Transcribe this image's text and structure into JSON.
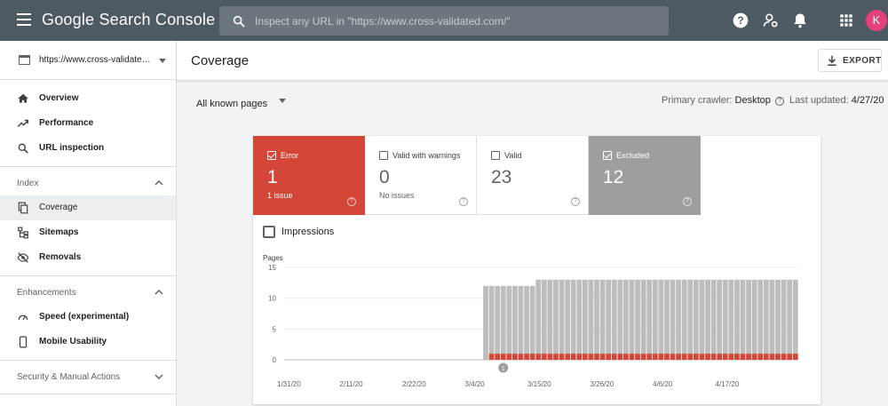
{
  "topbar": {
    "app_title": "Google Search Console",
    "search_placeholder": "Inspect any URL in \"https://www.cross-validated.com/\"",
    "icons": [
      "menu-icon",
      "search-icon",
      "help-icon",
      "manage-users-icon",
      "notifications-icon",
      "apps-icon"
    ],
    "avatar_initial": "K",
    "colors": {
      "bar": "#4d5a61",
      "avatar": "#e4407c"
    }
  },
  "sidebar": {
    "property": "https://www.cross-validated.com/",
    "top_items": [
      {
        "label": "Overview",
        "icon": "home-icon"
      },
      {
        "label": "Performance",
        "icon": "trending-up-icon"
      },
      {
        "label": "URL inspection",
        "icon": "search-icon"
      }
    ],
    "index_section": {
      "label": "Index",
      "items": [
        {
          "label": "Coverage",
          "icon": "copy-icon",
          "active": true
        },
        {
          "label": "Sitemaps",
          "icon": "sitemap-icon"
        },
        {
          "label": "Removals",
          "icon": "visibility-off-icon"
        }
      ]
    },
    "enhancements_section": {
      "label": "Enhancements",
      "items": [
        {
          "label": "Speed (experimental)",
          "icon": "speed-icon"
        },
        {
          "label": "Mobile Usability",
          "icon": "smartphone-icon"
        }
      ]
    },
    "security_section": {
      "label": "Security & Manual Actions"
    }
  },
  "header": {
    "title": "Coverage",
    "export_label": "EXPORT"
  },
  "filter": {
    "selected": "All known pages",
    "crawler_label": "Primary crawler:",
    "crawler_value": "Desktop",
    "updated_label": "Last updated:",
    "updated_value": "4/27/20"
  },
  "tiles": [
    {
      "label": "Error",
      "value": "1",
      "sub": "1 issue",
      "checked": true,
      "color": "#d44638"
    },
    {
      "label": "Valid with warnings",
      "value": "0",
      "sub": "No issues",
      "checked": false
    },
    {
      "label": "Valid",
      "value": "23",
      "sub": "",
      "checked": false
    },
    {
      "label": "Excluded",
      "value": "12",
      "sub": "",
      "checked": true,
      "color": "#9e9e9e"
    }
  ],
  "impressions_label": "Impressions",
  "annotation_marker": "1",
  "chart_data": {
    "type": "bar",
    "ylabel": "Pages",
    "ylim": [
      0,
      15
    ],
    "yticks": [
      0,
      5,
      10,
      15
    ],
    "xtick_labels": [
      "1/31/20",
      "2/11/20",
      "2/22/20",
      "3/4/20",
      "3/15/20",
      "3/26/20",
      "4/6/20",
      "4/17/20"
    ],
    "series": [
      {
        "name": "Error",
        "color": "#d44638",
        "values": [
          0,
          0,
          0,
          0,
          0,
          0,
          0,
          0,
          0,
          0,
          0,
          0,
          0,
          0,
          0,
          0,
          0,
          0,
          0,
          0,
          0,
          0,
          0,
          0,
          0,
          0,
          0,
          0,
          0,
          0,
          0,
          0,
          0,
          0,
          0,
          1,
          1,
          1,
          1,
          1,
          1,
          1,
          1,
          1,
          1,
          1,
          1,
          1,
          1,
          1,
          1,
          1,
          1,
          1,
          1,
          1,
          1,
          1,
          1,
          1,
          1,
          1,
          1,
          1,
          1,
          1,
          1,
          1,
          1,
          1,
          1,
          1,
          1,
          1,
          1,
          1,
          1,
          1,
          1,
          1,
          1,
          1,
          1,
          1,
          1,
          1,
          1,
          1
        ]
      },
      {
        "name": "Excluded",
        "color": "#bdbdbd",
        "values": [
          0,
          0,
          0,
          0,
          0,
          0,
          0,
          0,
          0,
          0,
          0,
          0,
          0,
          0,
          0,
          0,
          0,
          0,
          0,
          0,
          0,
          0,
          0,
          0,
          0,
          0,
          0,
          0,
          0,
          0,
          0,
          0,
          0,
          0,
          12,
          11,
          11,
          11,
          11,
          11,
          11,
          11,
          11,
          12,
          12,
          12,
          12,
          12,
          12,
          12,
          12,
          12,
          12,
          12,
          12,
          12,
          12,
          12,
          12,
          12,
          12,
          12,
          12,
          12,
          12,
          12,
          12,
          12,
          12,
          12,
          12,
          12,
          12,
          12,
          12,
          12,
          12,
          12,
          12,
          12,
          12,
          12,
          12,
          12,
          12,
          12,
          12,
          12
        ]
      }
    ]
  }
}
